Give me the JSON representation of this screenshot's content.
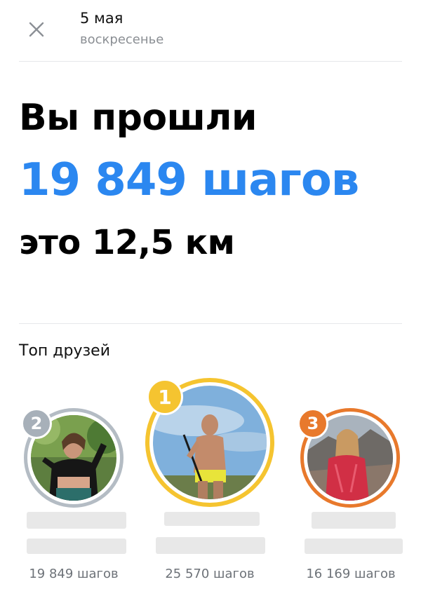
{
  "header": {
    "date": "5 мая",
    "weekday": "воскресенье"
  },
  "summary": {
    "line1": "Вы прошли",
    "line2": "19 849 шагов",
    "line3": "это 12,5 км"
  },
  "friends_section": {
    "title": "Топ друзей",
    "friends": [
      {
        "rank": "2",
        "steps_label": "19 849 шагов",
        "ring_color": "#b4bcc4",
        "badge_color": "#a7b0b9"
      },
      {
        "rank": "1",
        "steps_label": "25 570 шагов",
        "ring_color": "#f5c430",
        "badge_color": "#f5c430"
      },
      {
        "rank": "3",
        "steps_label": "16 169 шагов",
        "ring_color": "#e8792c",
        "badge_color": "#e8792c"
      }
    ]
  },
  "colors": {
    "accent_blue": "#2b87f0",
    "secondary_text": "#8a8e93"
  }
}
